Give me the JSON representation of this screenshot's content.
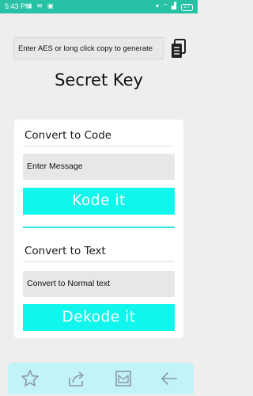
{
  "status_bar": {
    "time": "5:43 PM",
    "left_icons": "⊞ ✉ ▣",
    "right_icons": "▾ ⌔ ▟",
    "battery": "27"
  },
  "aes_field": {
    "text": "Enter AES or long click copy to generate"
  },
  "title": "Secret Key",
  "encode_section": {
    "title": "Convert to Code",
    "input_placeholder": "Enter Message",
    "button_label": "Kode it"
  },
  "decode_section": {
    "title": "Convert to Text",
    "input_placeholder": "Convert to Normal text",
    "button_label": "Dekode it"
  },
  "bottom_nav": {
    "items": [
      "star-icon",
      "share-icon",
      "mail-icon",
      "back-arrow-icon"
    ]
  },
  "colors": {
    "status_bar": "#27c2a6",
    "accent_cyan": "#10f5ec",
    "bottom_bar": "#c1f3f9",
    "background": "#efeeed"
  }
}
